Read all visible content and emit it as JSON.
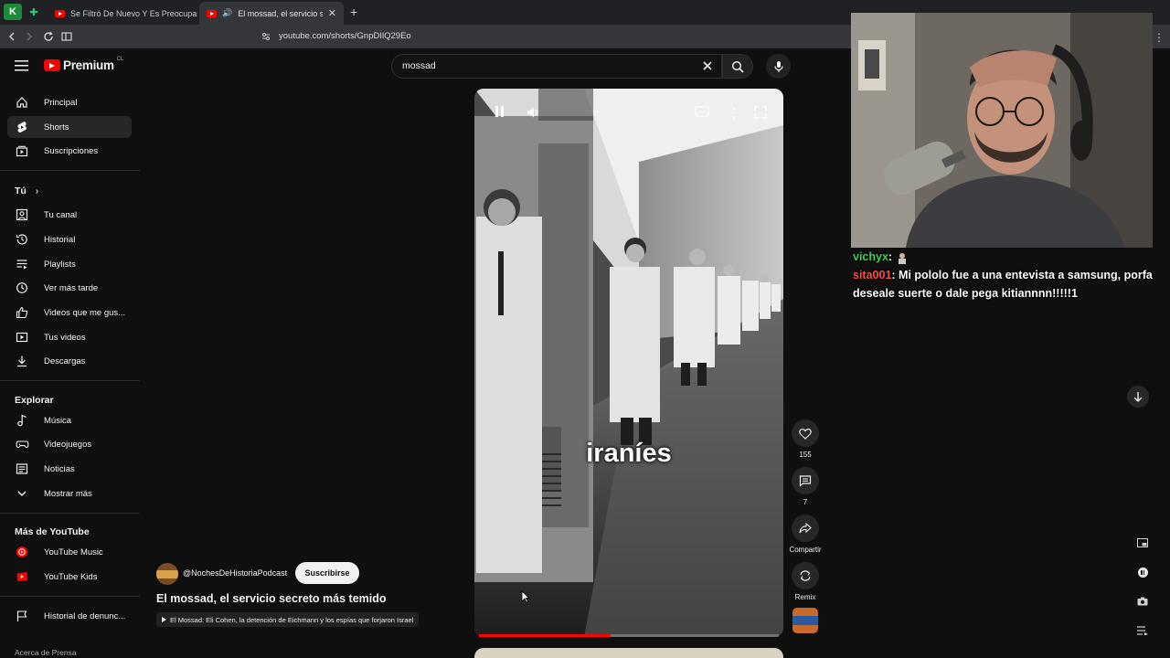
{
  "browser": {
    "tabs": [
      {
        "title": "Se Filtró De Nuevo Y Es Preocupante"
      },
      {
        "title": "El mossad, el servicio secreto"
      }
    ],
    "url": "youtube.com/shorts/GnpDIlQ29Eo"
  },
  "header": {
    "logo_text": "Premium",
    "logo_badge": "CL",
    "search_value": "mossad"
  },
  "sidebar": {
    "main": [
      {
        "label": "Principal",
        "icon": "home-icon"
      },
      {
        "label": "Shorts",
        "icon": "shorts-icon",
        "active": true
      },
      {
        "label": "Suscripciones",
        "icon": "subscriptions-icon"
      }
    ],
    "you_title": "Tú",
    "you": [
      {
        "label": "Tu canal",
        "icon": "channel-icon"
      },
      {
        "label": "Historial",
        "icon": "history-icon"
      },
      {
        "label": "Playlists",
        "icon": "playlists-icon"
      },
      {
        "label": "Ver más tarde",
        "icon": "watch-later-icon"
      },
      {
        "label": "Videos que me gus...",
        "icon": "like-icon"
      },
      {
        "label": "Tus videos",
        "icon": "your-videos-icon"
      },
      {
        "label": "Descargas",
        "icon": "download-icon"
      }
    ],
    "explore_title": "Explorar",
    "explore": [
      {
        "label": "Música",
        "icon": "music-icon"
      },
      {
        "label": "Videojuegos",
        "icon": "gaming-icon"
      },
      {
        "label": "Noticias",
        "icon": "news-icon"
      },
      {
        "label": "Mostrar más",
        "icon": "chevron-down-icon"
      }
    ],
    "more_title": "Más de YouTube",
    "more": [
      {
        "label": "YouTube Music",
        "icon": "youtube-music-icon"
      },
      {
        "label": "YouTube Kids",
        "icon": "youtube-kids-icon"
      }
    ],
    "report": {
      "label": "Historial de denunc...",
      "icon": "flag-icon"
    },
    "footer": "Acerca de  Prensa"
  },
  "short": {
    "caption": "iraníes",
    "likes": "155",
    "comments": "7",
    "share_label": "Compartir",
    "remix_label": "Remix",
    "channel": "@NochesDeHistoriaPodcast",
    "subscribe_label": "Suscribirse",
    "title": "El mossad, el servicio secreto más temido",
    "playlist": "El Mossad: Eli Cohen, la detención de Eichmann y los espías que forjaron Israel",
    "progress": 0.44
  },
  "stream": {
    "chat": [
      {
        "user": "vichyx",
        "message": ""
      },
      {
        "user": "sita001",
        "message": "Mi pololo fue a una entevista a samsung, porfa deseale suerte o dale pega kitiannnn!!!!!1"
      }
    ]
  },
  "colors": {
    "youtube_red": "#ff0000",
    "chat_user1": "#39d353",
    "chat_user2": "#ff4a4a"
  }
}
